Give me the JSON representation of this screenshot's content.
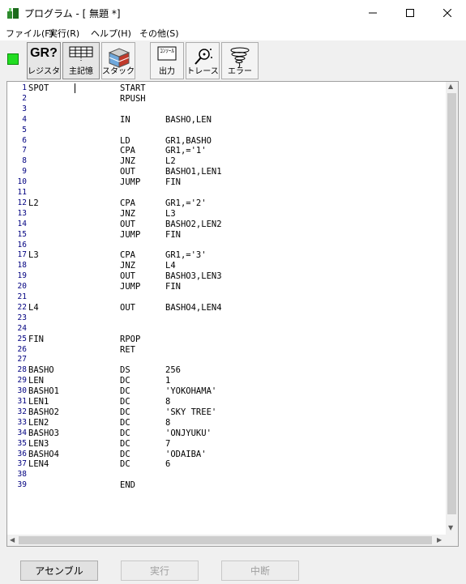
{
  "window": {
    "title": "プログラム - [ 無題 *]"
  },
  "menu": [
    "ファイル(F)",
    "実行(R)",
    "ヘルプ(H)",
    "その他(S)"
  ],
  "toolbar": {
    "status_color": "#22dd22",
    "register": {
      "icon_text": "GR?",
      "label": "レジスタ"
    },
    "memory": {
      "label": "主記憶"
    },
    "stack": {
      "label": "スタック"
    },
    "output": {
      "icon_text": "ｺﾝｿｰﾙ",
      "label": "出力"
    },
    "trace": {
      "label": "トレース"
    },
    "error": {
      "label": "エラー"
    }
  },
  "code": [
    {
      "n": "1",
      "label": "SPOT",
      "op": "START",
      "arg": ""
    },
    {
      "n": "2",
      "label": "",
      "op": "RPUSH",
      "arg": ""
    },
    {
      "n": "3",
      "label": "",
      "op": "",
      "arg": ""
    },
    {
      "n": "4",
      "label": "",
      "op": "IN",
      "arg": "BASHO,LEN"
    },
    {
      "n": "5",
      "label": "",
      "op": "",
      "arg": ""
    },
    {
      "n": "6",
      "label": "",
      "op": "LD",
      "arg": "GR1,BASHO"
    },
    {
      "n": "7",
      "label": "",
      "op": "CPA",
      "arg": "GR1,='1'"
    },
    {
      "n": "8",
      "label": "",
      "op": "JNZ",
      "arg": "L2"
    },
    {
      "n": "9",
      "label": "",
      "op": "OUT",
      "arg": "BASHO1,LEN1"
    },
    {
      "n": "10",
      "label": "",
      "op": "JUMP",
      "arg": "FIN"
    },
    {
      "n": "11",
      "label": "",
      "op": "",
      "arg": ""
    },
    {
      "n": "12",
      "label": "L2",
      "op": "CPA",
      "arg": "GR1,='2'"
    },
    {
      "n": "13",
      "label": "",
      "op": "JNZ",
      "arg": "L3"
    },
    {
      "n": "14",
      "label": "",
      "op": "OUT",
      "arg": "BASHO2,LEN2"
    },
    {
      "n": "15",
      "label": "",
      "op": "JUMP",
      "arg": "FIN"
    },
    {
      "n": "16",
      "label": "",
      "op": "",
      "arg": ""
    },
    {
      "n": "17",
      "label": "L3",
      "op": "CPA",
      "arg": "GR1,='3'"
    },
    {
      "n": "18",
      "label": "",
      "op": "JNZ",
      "arg": "L4"
    },
    {
      "n": "19",
      "label": "",
      "op": "OUT",
      "arg": "BASHO3,LEN3"
    },
    {
      "n": "20",
      "label": "",
      "op": "JUMP",
      "arg": "FIN"
    },
    {
      "n": "21",
      "label": "",
      "op": "",
      "arg": ""
    },
    {
      "n": "22",
      "label": "L4",
      "op": "OUT",
      "arg": "BASHO4,LEN4"
    },
    {
      "n": "23",
      "label": "",
      "op": "",
      "arg": ""
    },
    {
      "n": "24",
      "label": "",
      "op": "",
      "arg": ""
    },
    {
      "n": "25",
      "label": "FIN",
      "op": "RPOP",
      "arg": ""
    },
    {
      "n": "26",
      "label": "",
      "op": "RET",
      "arg": ""
    },
    {
      "n": "27",
      "label": "",
      "op": "",
      "arg": ""
    },
    {
      "n": "28",
      "label": "BASHO",
      "op": "DS",
      "arg": "256"
    },
    {
      "n": "29",
      "label": "LEN",
      "op": "DC",
      "arg": "1"
    },
    {
      "n": "30",
      "label": "BASHO1",
      "op": "DC",
      "arg": "'YOKOHAMA'"
    },
    {
      "n": "31",
      "label": "LEN1",
      "op": "DC",
      "arg": "8"
    },
    {
      "n": "32",
      "label": "BASHO2",
      "op": "DC",
      "arg": "'SKY TREE'"
    },
    {
      "n": "33",
      "label": "LEN2",
      "op": "DC",
      "arg": "8"
    },
    {
      "n": "34",
      "label": "BASHO3",
      "op": "DC",
      "arg": "'ONJYUKU'"
    },
    {
      "n": "35",
      "label": "LEN3",
      "op": "DC",
      "arg": "7"
    },
    {
      "n": "36",
      "label": "BASHO4",
      "op": "DC",
      "arg": "'ODAIBA'"
    },
    {
      "n": "37",
      "label": "LEN4",
      "op": "DC",
      "arg": "6"
    },
    {
      "n": "38",
      "label": "",
      "op": "",
      "arg": ""
    },
    {
      "n": "39",
      "label": "",
      "op": "END",
      "arg": ""
    }
  ],
  "buttons": {
    "assemble": "アセンブル",
    "run": "実行",
    "stop": "中断"
  }
}
